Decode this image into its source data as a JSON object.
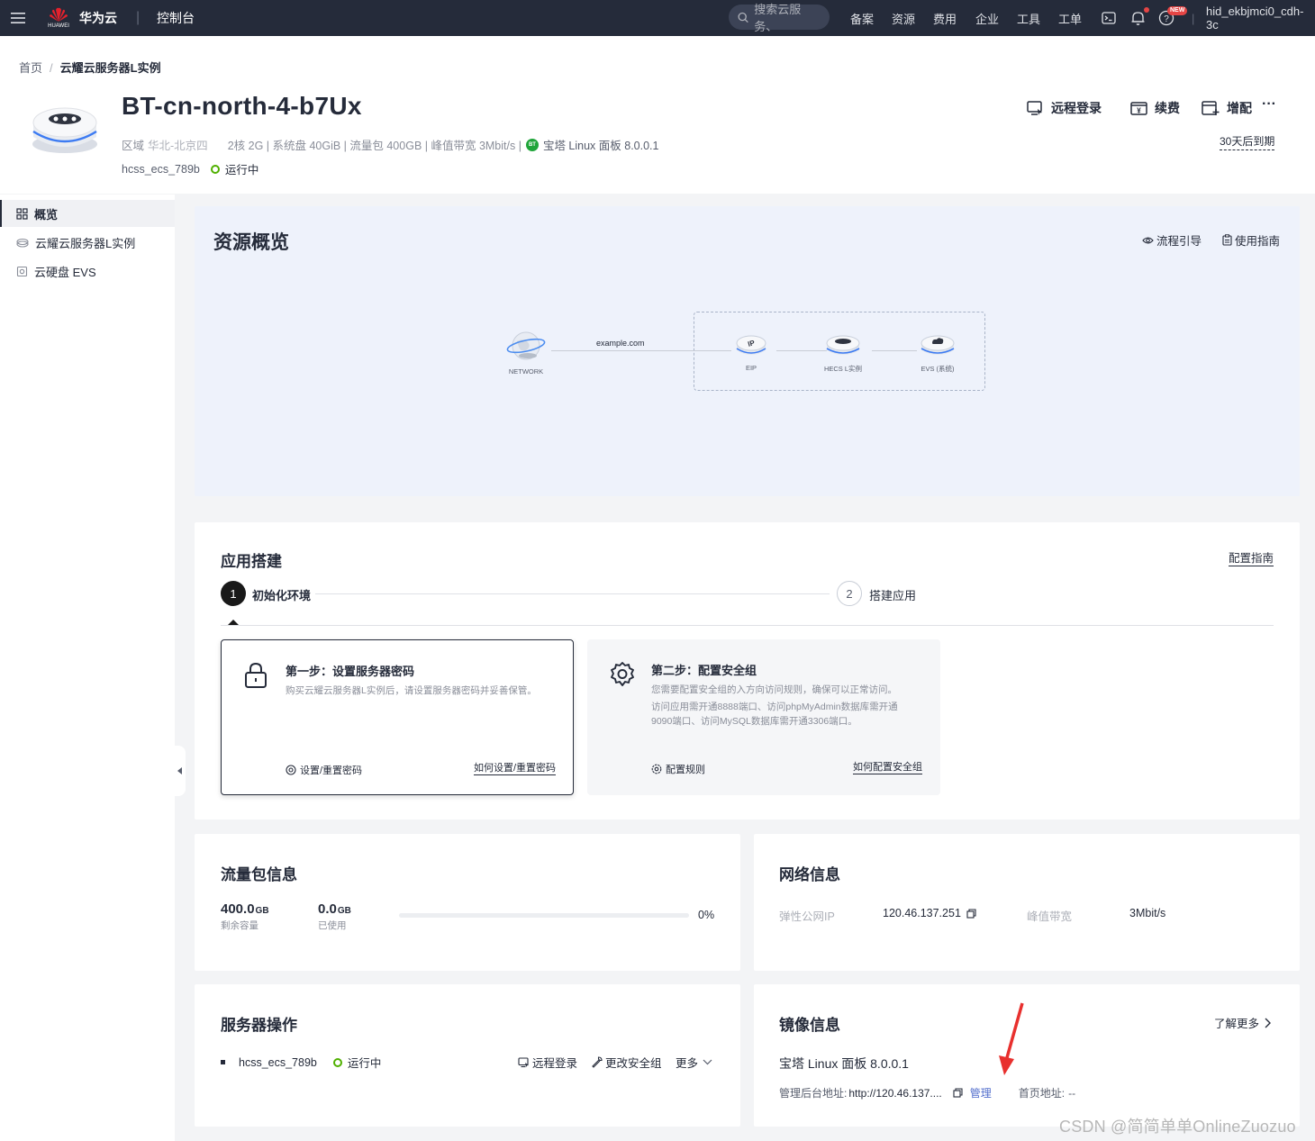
{
  "topbar": {
    "brand_logo_text": "HUAWEI",
    "brand": "华为云",
    "separator": "|",
    "console": "控制台",
    "search_placeholder": "搜索云服务、",
    "nav": [
      "备案",
      "资源",
      "费用",
      "企业",
      "工具",
      "工单"
    ],
    "new_badge": "NEW",
    "user": "hid_ekbjmci0_cdh-3c"
  },
  "breadcrumb": {
    "home": "首页",
    "separator": "/",
    "current": "云耀云服务器L实例"
  },
  "instance": {
    "name": "BT-cn-north-4-b7Ux",
    "region_label": "区域",
    "region_value": "华北-北京四",
    "specs": "2核  2G | 系统盘 40GiB | 流量包 400GB | 峰值带宽 3Mbit/s |",
    "bt_badge": "BT",
    "image": "宝塔 Linux 面板 8.0.0.1",
    "id": "hcss_ecs_789b",
    "status": "运行中",
    "actions": {
      "remote_login": "远程登录",
      "renew": "续费",
      "upgrade": "增配",
      "more": "···"
    },
    "expire": "30天后到期"
  },
  "sidebar": {
    "items": [
      {
        "label": "概览",
        "icon": "grid-icon"
      },
      {
        "label": "云耀云服务器L实例",
        "icon": "cloud-icon"
      },
      {
        "label": "云硬盘 EVS",
        "icon": "disk-icon"
      }
    ]
  },
  "overview": {
    "title": "资源概览",
    "guide_link": "流程引导",
    "manual_link": "使用指南",
    "topology": {
      "network": "NETWORK",
      "domain": "example.com",
      "eip": "EIP",
      "eip_text": "IP",
      "hecs": "HECS L实例",
      "evs": "EVS (系统)"
    }
  },
  "appbuild": {
    "title": "应用搭建",
    "guide": "配置指南",
    "steps": [
      {
        "num": "1",
        "label": "初始化环境"
      },
      {
        "num": "2",
        "label": "搭建应用"
      }
    ],
    "card1": {
      "title": "第一步：设置服务器密码",
      "desc": "购买云耀云服务器L实例后，请设置服务器密码并妥善保管。",
      "action": "设置/重置密码",
      "link": "如何设置/重置密码"
    },
    "card2": {
      "title": "第二步：配置安全组",
      "desc1": "您需要配置安全组的入方向访问规则，确保可以正常访问。",
      "desc2": "访问应用需开通8888端口、访问phpMyAdmin数据库需开通9090端口、访问MySQL数据库需开通3306端口。",
      "action": "配置规则",
      "link": "如何配置安全组"
    }
  },
  "traffic": {
    "title": "流量包信息",
    "remaining_value": "400.0",
    "remaining_unit": "GB",
    "remaining_label": "剩余容量",
    "used_value": "0.0",
    "used_unit": "GB",
    "used_label": "已使用",
    "percent_text": "0%",
    "used_fraction": 0
  },
  "network": {
    "title": "网络信息",
    "eip_label": "弹性公网IP",
    "eip_value": "120.46.137.251",
    "bw_label": "峰值带宽",
    "bw_value": "3Mbit/s"
  },
  "server_ops": {
    "title": "服务器操作",
    "id": "hcss_ecs_789b",
    "status": "运行中",
    "remote_login": "远程登录",
    "change_sg": "更改安全组",
    "more": "更多"
  },
  "mirror": {
    "title": "镜像信息",
    "learn_more": "了解更多",
    "name": "宝塔 Linux 面板 8.0.0.1",
    "admin_label": "管理后台地址:",
    "admin_url": "http://120.46.137....",
    "manage": "管理",
    "home_label": "首页地址:",
    "home_value": "--"
  },
  "watermark": "CSDN @简简单单OnlineZuozuo",
  "colors": {
    "topbar": "#252b3a",
    "running": "#50b000",
    "link_blue": "#526ecc",
    "overview_bg": "#eef2fb",
    "bt_green": "#20a53a",
    "annotation_red": "#e8302e"
  }
}
